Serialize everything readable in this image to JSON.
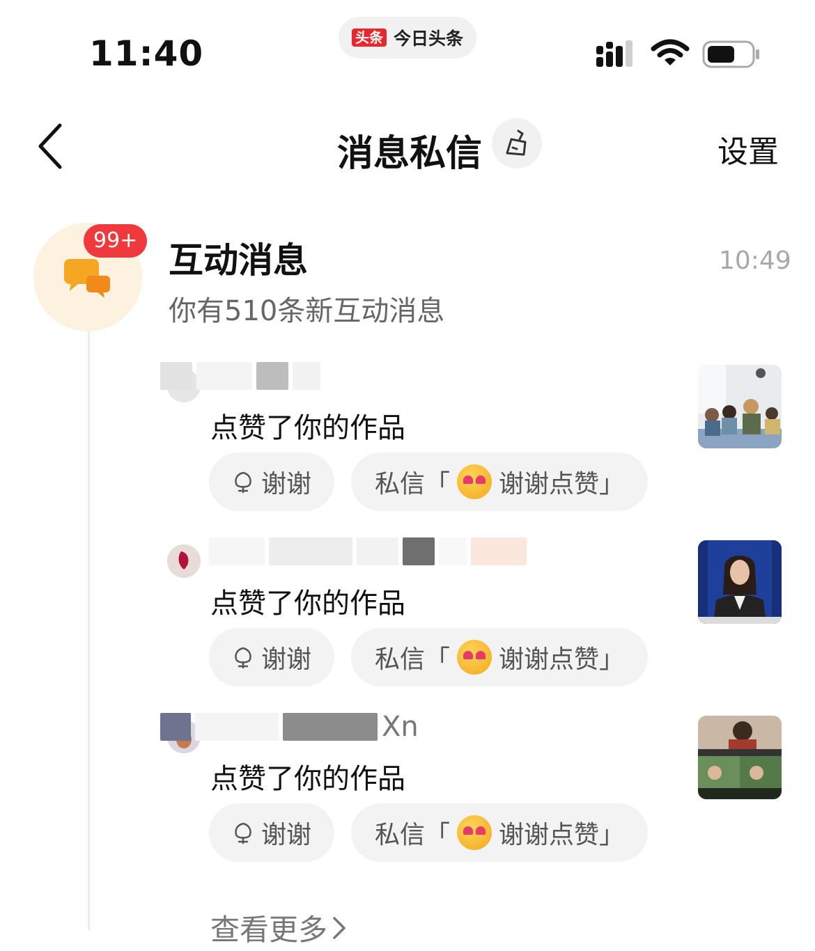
{
  "status_bar": {
    "time": "11:40",
    "app_logo": "头条",
    "app_name": "今日头条",
    "icons": [
      "signal-icon",
      "wifi-icon",
      "battery-icon"
    ]
  },
  "header": {
    "back_icon": "chevron-left-icon",
    "title": "消息私信",
    "clean_icon": "broom-icon",
    "settings_label": "设置"
  },
  "interaction": {
    "icon": "chat-bubbles-icon",
    "badge": "99+",
    "title": "互动消息",
    "time": "10:49",
    "subtitle": "你有510条新互动消息",
    "items": [
      {
        "visible_name_fragment": "",
        "action": "点赞了你的作品",
        "thanks_label": "谢谢",
        "dm_prefix": "私信「",
        "dm_text": "谢谢点赞」",
        "thumb_desc": "classroom"
      },
      {
        "visible_name_fragment": "",
        "action": "点赞了你的作品",
        "thanks_label": "谢谢",
        "dm_prefix": "私信「",
        "dm_text": "谢谢点赞」",
        "thumb_desc": "speaker"
      },
      {
        "visible_name_fragment": "Xn",
        "action": "点赞了你的作品",
        "thanks_label": "谢谢",
        "dm_prefix": "私信「",
        "dm_text": "谢谢点赞」",
        "thumb_desc": "news"
      }
    ],
    "see_more": "查看更多"
  },
  "colors": {
    "badge": "#f0393c",
    "accent_orange": "#f5a623",
    "avatar_bg": "#fdf1e0",
    "pill_bg": "#f3f3f3"
  }
}
